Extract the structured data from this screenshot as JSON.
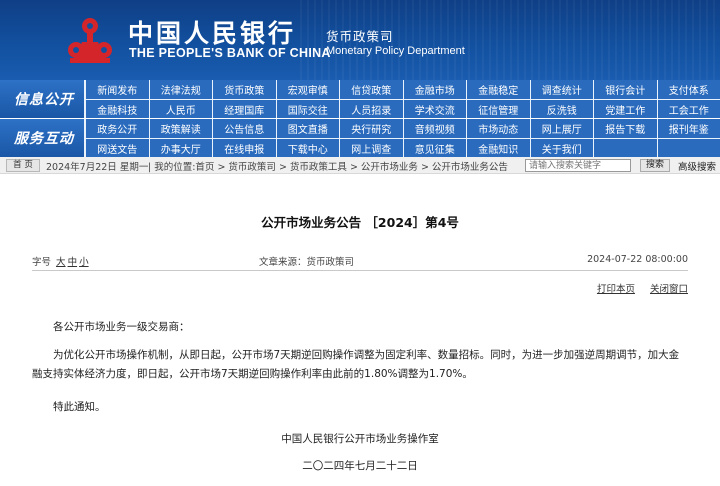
{
  "header": {
    "bank_name_cn": "中国人民银行",
    "bank_name_en": "THE PEOPLE'S BANK OF CHINA",
    "department_cn": "货币政策司",
    "department_en": "Monetary Policy Department",
    "logo_color": "#d4262a"
  },
  "nav": {
    "row1_label": "信息公开",
    "row1_items": [
      "新闻发布",
      "法律法规",
      "货币政策",
      "宏观审慎",
      "信贷政策",
      "金融市场",
      "金融稳定",
      "调查统计",
      "银行会计",
      "支付体系",
      "金融科技",
      "人民币",
      "经理国库",
      "国际交往",
      "人员招录",
      "学术交流",
      "征信管理",
      "反洗钱",
      "党建工作",
      "工会工作"
    ],
    "row2_label": "服务互动",
    "row2_items": [
      "政务公开",
      "政策解读",
      "公告信息",
      "图文直播",
      "央行研究",
      "音频视频",
      "市场动态",
      "网上展厅",
      "报告下载",
      "报刊年鉴",
      "网送文告",
      "办事大厅",
      "在线申报",
      "下载中心",
      "网上调查",
      "意见征集",
      "金融知识",
      "关于我们",
      "",
      ""
    ]
  },
  "crumbbar": {
    "home_label": "首 页",
    "date_text": "2024年7月22日 星期一",
    "path_text": "| 我的位置:首页 > 货币政策司 > 货币政策工具 > 公开市场业务 > 公开市场业务公告",
    "search_placeholder": "请输入搜索关键字",
    "search_button": "搜索",
    "advanced_search": "高级搜索"
  },
  "article": {
    "title": "公开市场业务公告 ［2024］第4号",
    "font_size_label": "字号",
    "font_sizes": [
      "大",
      "中",
      "小"
    ],
    "source": "文章来源：货币政策司",
    "datetime": "2024-07-22 08:00:00",
    "print_label": "打印本页",
    "close_label": "关闭窗口",
    "greeting": "各公开市场业务一级交易商：",
    "paragraph": "为优化公开市场操作机制，从即日起，公开市场7天期逆回购操作调整为固定利率、数量招标。同时，为进一步加强逆周期调节，加大金融支持实体经济力度，即日起，公开市场7天期逆回购操作利率由此前的1.80%调整为1.70%。",
    "notice": "特此通知。",
    "signature_org": "中国人民银行公开市场业务操作室",
    "signature_date": "二〇二四年七月二十二日"
  }
}
